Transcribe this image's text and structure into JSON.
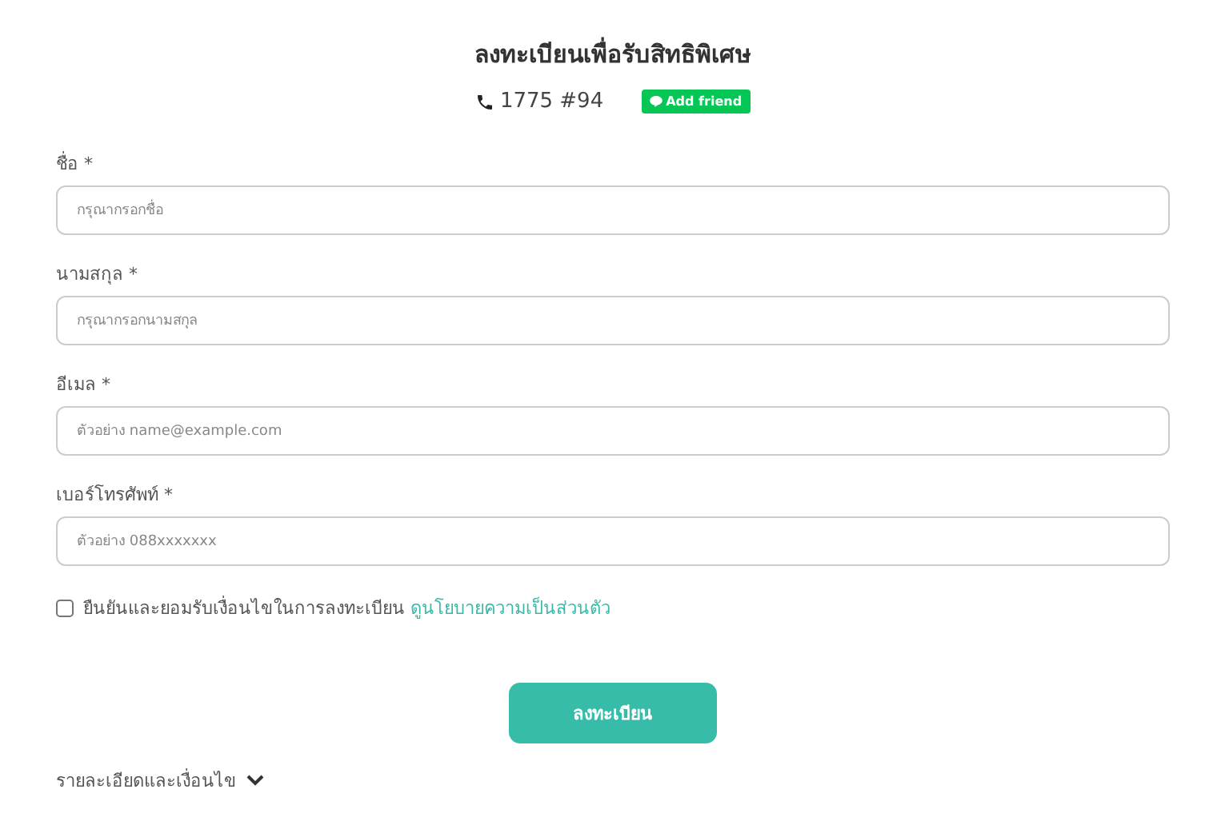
{
  "header": {
    "title": "ลงทะเบียนเพื่อรับสิทธิพิเศษ",
    "phone": "1775 #94",
    "add_friend": "Add friend"
  },
  "fields": [
    {
      "label": "ชื่อ *",
      "placeholder": "กรุณากรอกชื่อ"
    },
    {
      "label": "นามสกุล *",
      "placeholder": "กรุณากรอกนามสกุล"
    },
    {
      "label": "อีเมล *",
      "placeholder": "ตัวอย่าง name@example.com"
    },
    {
      "label": "เบอร์โทรศัพท์ *",
      "placeholder": "ตัวอย่าง 088xxxxxxx"
    }
  ],
  "consent": {
    "text": "ยืนยันและยอมรับเงื่อนไขในการลงทะเบียน",
    "link": "ดูนโยบายความเป็นส่วนตัว",
    "checked": false
  },
  "submit": "ลงทะเบียน",
  "details": {
    "label": "รายละเอียดและเงื่อนไข",
    "expanded": false
  }
}
